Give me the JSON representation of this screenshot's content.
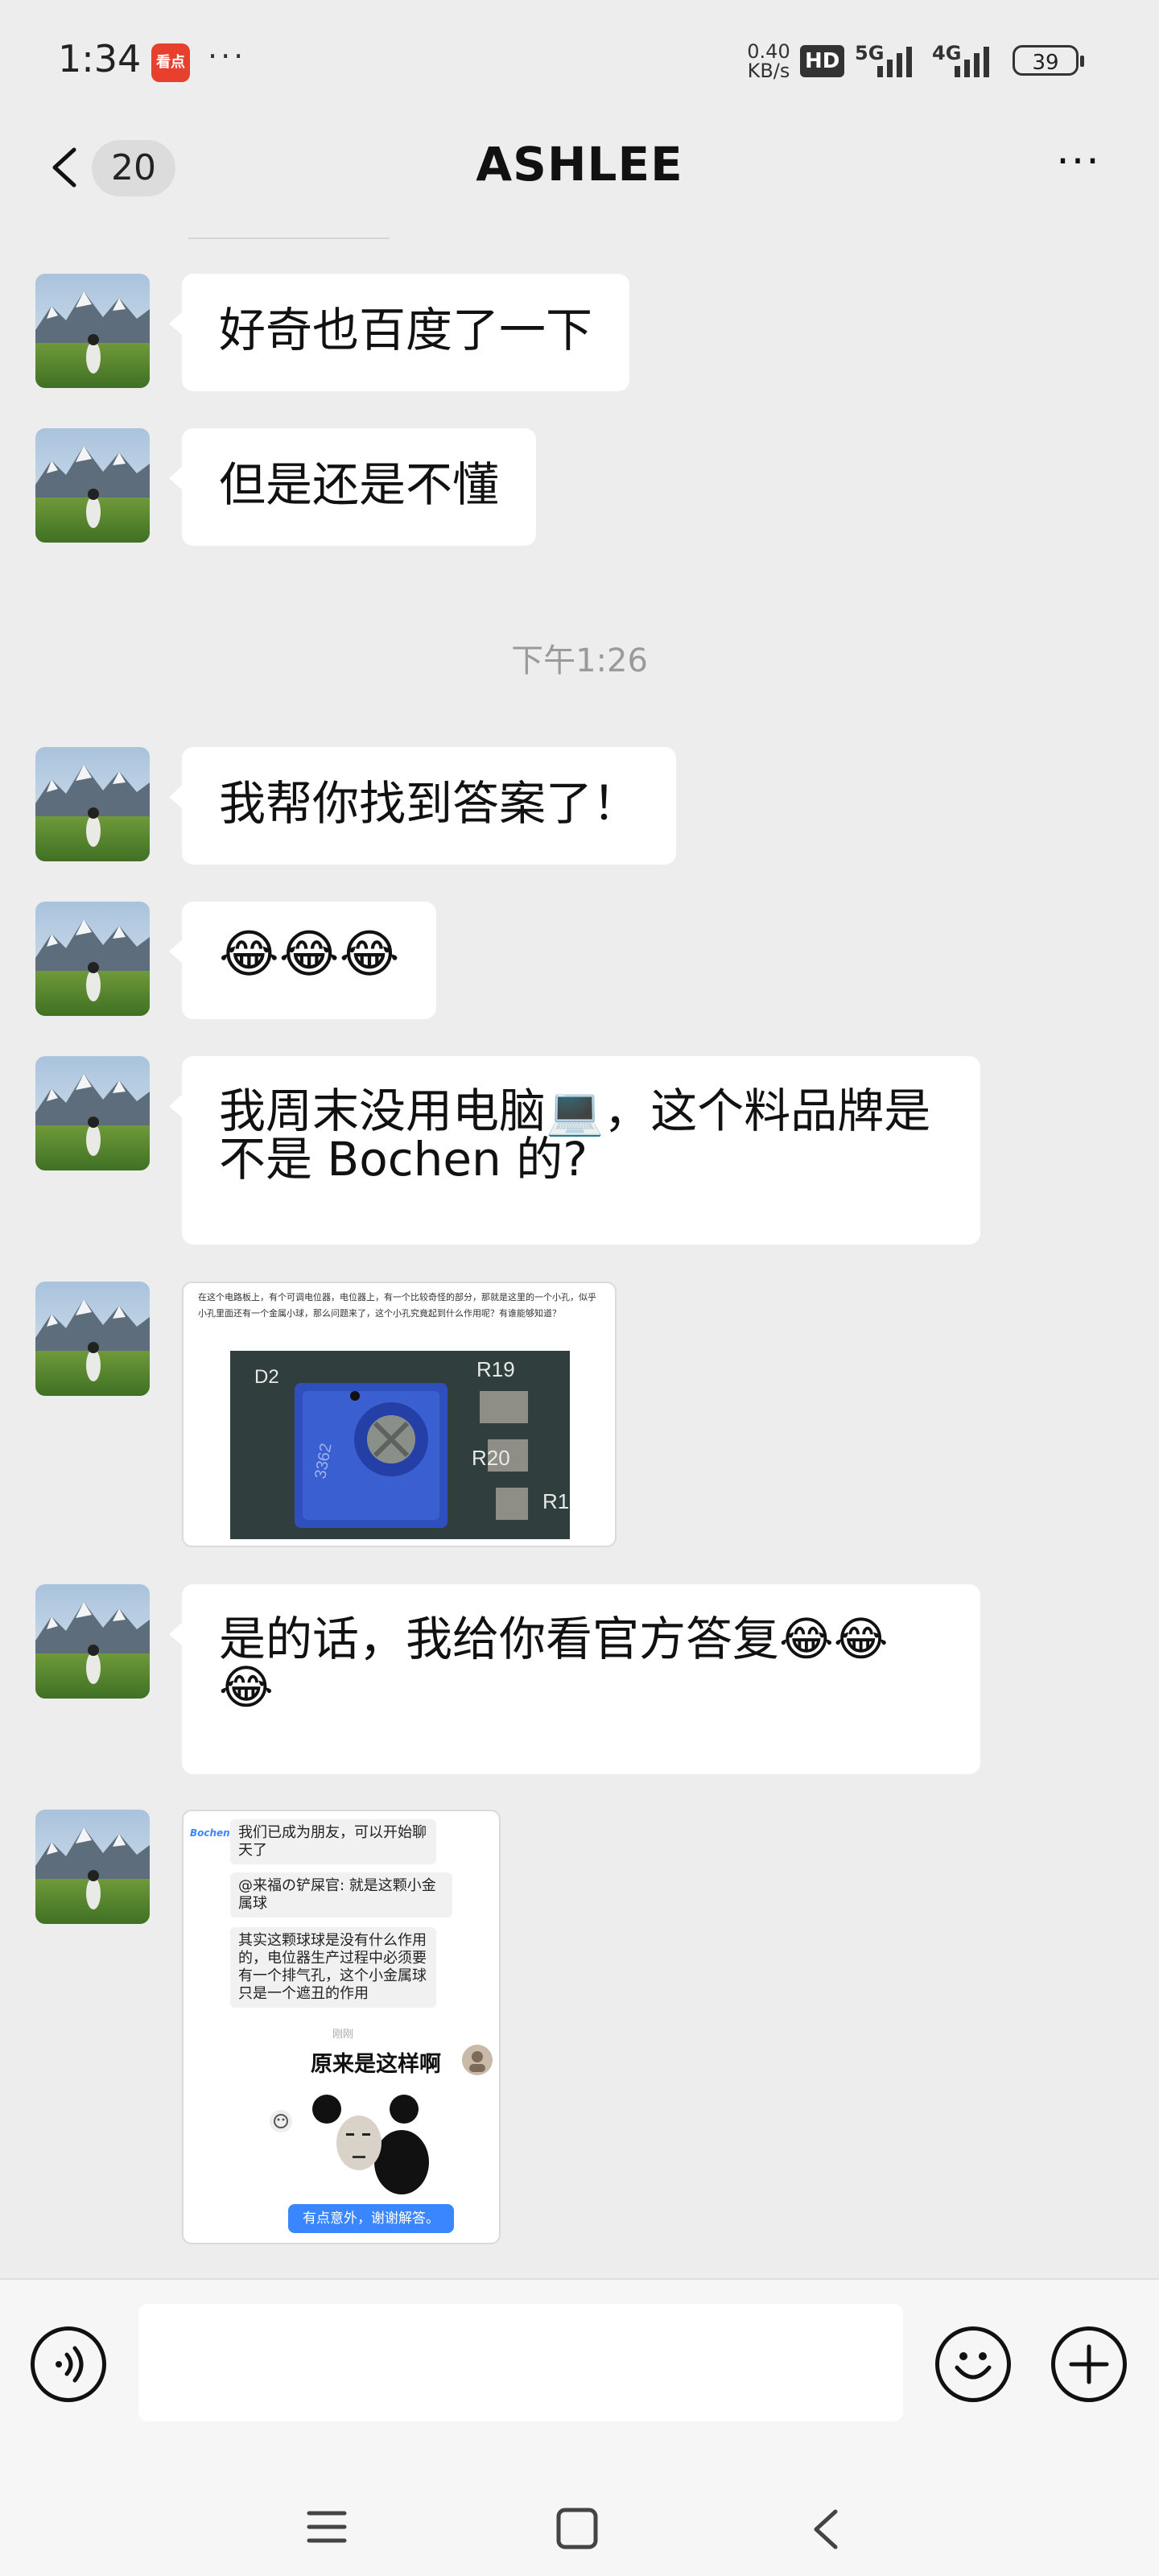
{
  "status_bar": {
    "time": "1:34",
    "app_icon_text": "看点",
    "more_dots": "···",
    "net_speed_value": "0.40",
    "net_speed_unit": "KB/s",
    "hd_label": "HD",
    "signal_1": "5G",
    "signal_2": "4G",
    "battery": "39"
  },
  "header": {
    "unread_count": "20",
    "title": "ASHLEE",
    "more_label": "···"
  },
  "messages": [
    {
      "type": "text",
      "text": "好奇也百度了一下"
    },
    {
      "type": "text",
      "text": "但是还是不懂"
    },
    {
      "type": "time",
      "text": "下午1:26"
    },
    {
      "type": "text",
      "text": "我帮你找到答案了！"
    },
    {
      "type": "emoji",
      "emoji": "😂😂😂"
    },
    {
      "type": "text",
      "line1": "我周末没用电脑💻，这个料品牌是",
      "line2": "不是 Bochen 的?"
    },
    {
      "type": "image",
      "caption": "在这个电路板上，有个可调电位器，电位器上，有一个比较奇怪的部分，那就是这里的一个小孔，似乎小孔里面还有一个金属小球，那么问题来了，这个小孔究竟起到什么作用呢？有谁能够知道？",
      "labels": [
        "D2",
        "R19",
        "R20",
        "R1",
        "3362"
      ]
    },
    {
      "type": "text",
      "line1": "是的话，我给你看官方答复😂😂",
      "line2": "😂"
    },
    {
      "type": "image",
      "chat": {
        "logo": "Bochen",
        "msg1": "我们已成为朋友，可以开始聊天了",
        "msg2": "@来福の铲屎官: 就是这颗小金属球",
        "msg3": "其实这颗球球是没有什么作用的，电位器生产过程中必须要有一个排气孔，这个小金属球只是一个遮丑的作用",
        "time": "刚刚",
        "reply": "原来是这样啊",
        "button": "有点意外，谢谢解答。"
      }
    }
  ],
  "input": {
    "placeholder": ""
  },
  "colors": {
    "background": "#ededed",
    "bubble": "#ffffff",
    "accent_blue": "#3a86ff",
    "time_gray": "#9a9a9a"
  },
  "icons": [
    "back-icon",
    "more-icon",
    "voice-icon",
    "emoji-icon",
    "plus-icon",
    "menu-nav-icon",
    "home-nav-icon",
    "back-nav-icon"
  ]
}
